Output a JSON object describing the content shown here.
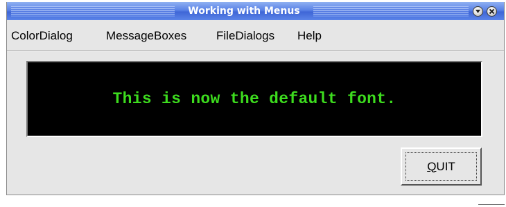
{
  "window": {
    "title": "Working with Menus",
    "titlebar_color": "#5a82e6",
    "controls": {
      "minimize_icon": "chevron-down-icon",
      "close_icon": "close-icon"
    }
  },
  "menubar": {
    "items": [
      {
        "label": "ColorDialog"
      },
      {
        "label": "MessageBoxes"
      },
      {
        "label": "FileDialogs"
      },
      {
        "label": "Help"
      }
    ]
  },
  "display": {
    "message": "This is now the default font.",
    "text_color": "#3ddc1e",
    "background_color": "#000000"
  },
  "quit_button": {
    "mnemonic": "Q",
    "rest": "UIT"
  }
}
